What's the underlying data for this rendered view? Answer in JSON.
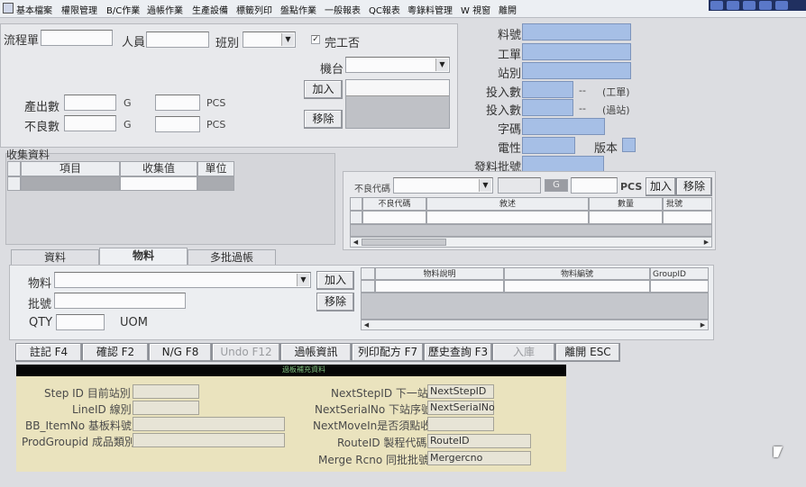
{
  "menu": {
    "items": [
      "基本檔案",
      "權限管理",
      "B/C作業",
      "過帳作業",
      "生產設備",
      "標籤列印",
      "盤點作業",
      "一般報表",
      "QC報表",
      "粵錄料管理",
      "W 視窗",
      "離開"
    ]
  },
  "top_form": {
    "flow_sheet_label": "流程單",
    "staff_label": "人員",
    "shift_label": "班別",
    "complete_label": "完工否",
    "machine_label": "機台",
    "add_label": "加入",
    "remove_label": "移除",
    "output_qty_label": "產出數",
    "defect_qty_label": "不良數",
    "unit_g": "G",
    "unit_pcs": "PCS"
  },
  "right_form": {
    "material_no_label": "料號",
    "work_order_label": "工單",
    "station_label": "站別",
    "input_qty_label": "投入數",
    "input_qty_note1": "--",
    "work_order_note": "(工單)",
    "input_qty_note2": "--",
    "pass_note": "(過站)",
    "font_code_label": "字碼",
    "electrical_label": "電性",
    "version_label": "版本",
    "issue_batch_label": "發料批號"
  },
  "collect": {
    "section_title": "收集資料",
    "columns": [
      "項目",
      "收集值",
      "單位"
    ]
  },
  "defect_panel": {
    "defect_code_label": "不良代碼",
    "unit_g": "G",
    "unit_pcs": "PCS",
    "add_label": "加入",
    "remove_label": "移除",
    "columns": [
      "不良代碼",
      "敘述",
      "數量",
      "批號"
    ]
  },
  "tabs": [
    "資料",
    "物料",
    "多批過帳"
  ],
  "material_tab": {
    "material_label": "物料",
    "batch_label": "批號",
    "qty_label": "QTY",
    "uom_label": "UOM",
    "add_label": "加入",
    "remove_label": "移除",
    "columns": [
      "物料說明",
      "物料編號",
      "GroupID"
    ]
  },
  "buttons": [
    "註記 F4",
    "確認 F2",
    "N/G F8",
    "Undo F12",
    "過帳資訊",
    "列印配方 F7",
    "歷史查詢 F3",
    "入庫",
    "離開 ESC"
  ],
  "info_bar_text": "過板補充資料",
  "info_panel": {
    "left_labels": [
      "Step ID 目前站別",
      "LineID 線別",
      "BB_ItemNo 基板料號",
      "ProdGroupid 成品類別"
    ],
    "right_labels": [
      "NextStepID 下一站",
      "NextSerialNo 下站序號",
      "NextMoveIn是否須點收",
      "RouteID 製程代碼",
      "Merge Rcno 同批批號"
    ],
    "right_values": [
      "NextStepID",
      "NextSerialNo",
      "",
      "RouteID",
      "Mergercno"
    ]
  },
  "colors": {
    "blue_field": "#a6bfe6",
    "panel_yellow": "#eae3be",
    "info_bar": "#060606"
  }
}
